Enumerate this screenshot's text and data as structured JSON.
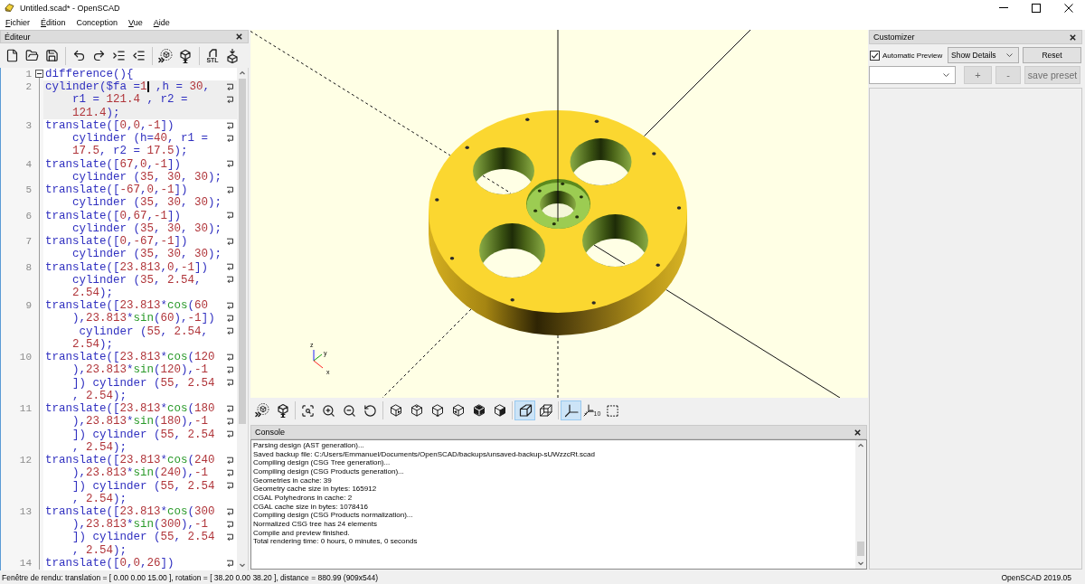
{
  "window": {
    "title": "Untitled.scad* - OpenSCAD"
  },
  "menu": [
    {
      "label": "Fichier",
      "underline_first": true
    },
    {
      "label": "Édition",
      "underline_first": true
    },
    {
      "label": "Conception",
      "underline_first": false
    },
    {
      "label": "Vue",
      "underline_first": true
    },
    {
      "label": "Aide",
      "underline_first": true
    }
  ],
  "editor": {
    "title": "Éditeur",
    "toolbar": [
      {
        "kind": "new"
      },
      {
        "kind": "open"
      },
      {
        "kind": "save"
      },
      {
        "kind": "separator"
      },
      {
        "kind": "undo"
      },
      {
        "kind": "redo"
      },
      {
        "kind": "indent"
      },
      {
        "kind": "unindent"
      },
      {
        "kind": "separator"
      },
      {
        "kind": "preview"
      },
      {
        "kind": "render"
      },
      {
        "kind": "separator"
      },
      {
        "kind": "export_stl",
        "text": "STL"
      },
      {
        "kind": "send_to_print"
      }
    ],
    "lines": [
      {
        "number": "1",
        "fold": true,
        "current": false,
        "continues": false,
        "rows": [
          {
            "text": "difference(){"
          }
        ]
      },
      {
        "number": "2",
        "fold": false,
        "current": true,
        "continues": false,
        "rows": [
          {
            "text": "cylinder($fa =1",
            "cursor_after": true,
            "text_after": " ,h = 30,"
          },
          {
            "text": "r1 = 121.4 , r2 ="
          },
          {
            "text": "121.4);"
          }
        ]
      },
      {
        "number": "3",
        "fold": false,
        "current": false,
        "continues": false,
        "rows": [
          {
            "text": "translate([0,0,-1])"
          },
          {
            "text": "cylinder (h=40, r1 ="
          },
          {
            "text": "17.5, r2 = 17.5);"
          }
        ]
      },
      {
        "number": "4",
        "fold": false,
        "current": false,
        "continues": false,
        "rows": [
          {
            "text": "translate([67,0,-1])"
          },
          {
            "text": "cylinder (35, 30, 30);"
          }
        ]
      },
      {
        "number": "5",
        "fold": false,
        "current": false,
        "continues": false,
        "rows": [
          {
            "text": "translate([-67,0,-1])"
          },
          {
            "text": "cylinder (35, 30, 30);"
          }
        ]
      },
      {
        "number": "6",
        "fold": false,
        "current": false,
        "continues": false,
        "rows": [
          {
            "text": "translate([0,67,-1])"
          },
          {
            "text": "cylinder (35, 30, 30);"
          }
        ]
      },
      {
        "number": "7",
        "fold": false,
        "current": false,
        "continues": false,
        "rows": [
          {
            "text": "translate([0,-67,-1])"
          },
          {
            "text": "cylinder (35, 30, 30);"
          }
        ]
      },
      {
        "number": "8",
        "fold": false,
        "current": false,
        "continues": false,
        "rows": [
          {
            "text": "translate([23.813,0,-1])"
          },
          {
            "text": "cylinder (35, 2.54,"
          },
          {
            "text": "2.54);"
          }
        ]
      },
      {
        "number": "9",
        "fold": false,
        "current": false,
        "continues": false,
        "rows": [
          {
            "text": "translate([23.813*cos(60"
          },
          {
            "text": "),23.813*sin(60),-1])"
          },
          {
            "text": " cylinder (55, 2.54,"
          },
          {
            "text": "2.54);"
          }
        ]
      },
      {
        "number": "10",
        "fold": false,
        "current": false,
        "continues": false,
        "rows": [
          {
            "text": "translate([23.813*cos(120"
          },
          {
            "text": "),23.813*sin(120),-1"
          },
          {
            "text": "]) cylinder (55, 2.54"
          },
          {
            "text": ", 2.54);"
          }
        ]
      },
      {
        "number": "11",
        "fold": false,
        "current": false,
        "continues": false,
        "rows": [
          {
            "text": "translate([23.813*cos(180"
          },
          {
            "text": "),23.813*sin(180),-1"
          },
          {
            "text": "]) cylinder (55, 2.54"
          },
          {
            "text": ", 2.54);"
          }
        ]
      },
      {
        "number": "12",
        "fold": false,
        "current": false,
        "continues": false,
        "rows": [
          {
            "text": "translate([23.813*cos(240"
          },
          {
            "text": "),23.813*sin(240),-1"
          },
          {
            "text": "]) cylinder (55, 2.54"
          },
          {
            "text": ", 2.54);"
          }
        ]
      },
      {
        "number": "13",
        "fold": false,
        "current": false,
        "continues": false,
        "rows": [
          {
            "text": "translate([23.813*cos(300"
          },
          {
            "text": "),23.813*sin(300),-1"
          },
          {
            "text": "]) cylinder (55, 2.54"
          },
          {
            "text": ", 2.54);"
          }
        ]
      },
      {
        "number": "14",
        "fold": false,
        "current": false,
        "continues": true,
        "rows": [
          {
            "text": "translate([0,0,26])"
          }
        ]
      }
    ]
  },
  "viewport": {
    "axis_labels": [
      "z",
      "y",
      "x"
    ]
  },
  "viewport_toolbar": [
    {
      "kind": "preview",
      "selected": false
    },
    {
      "kind": "render",
      "selected": false
    },
    {
      "kind": "separator"
    },
    {
      "kind": "view_all",
      "selected": false
    },
    {
      "kind": "zoom_in",
      "selected": false
    },
    {
      "kind": "zoom_out",
      "selected": false
    },
    {
      "kind": "reset_view",
      "selected": false
    },
    {
      "kind": "separator"
    },
    {
      "kind": "view_right",
      "selected": false
    },
    {
      "kind": "view_top",
      "selected": false
    },
    {
      "kind": "view_bottom",
      "selected": false
    },
    {
      "kind": "view_left",
      "selected": false
    },
    {
      "kind": "view_front",
      "selected": false
    },
    {
      "kind": "view_back",
      "selected": false
    },
    {
      "kind": "separator"
    },
    {
      "kind": "perspective",
      "selected": true
    },
    {
      "kind": "orthogonal",
      "selected": false
    },
    {
      "kind": "separator"
    },
    {
      "kind": "show_axes",
      "selected": true
    },
    {
      "kind": "show_scale_markers",
      "selected": false,
      "text": "10"
    },
    {
      "kind": "show_edges",
      "selected": false
    }
  ],
  "console": {
    "title": "Console",
    "messages": [
      "Parsing design (AST generation)...",
      "Saved backup file: C:/Users/Emmanuel/Documents/OpenSCAD/backups/unsaved-backup-sUWzzcRt.scad",
      "Compiling design (CSG Tree generation)...",
      "Compiling design (CSG Products generation)...",
      "Geometries in cache: 39",
      "Geometry cache size in bytes: 165912",
      "CGAL Polyhedrons in cache: 2",
      "CGAL cache size in bytes: 1078416",
      "Compiling design (CSG Products normalization)...",
      "Normalized CSG tree has 24 elements",
      "Compile and preview finished.",
      "Total rendering time: 0 hours, 0 minutes, 0 seconds"
    ]
  },
  "customizer": {
    "title": "Customizer",
    "automatic_preview": {
      "label": "Automatic Preview",
      "checked": true
    },
    "details": {
      "value": "Show Details"
    },
    "reset": {
      "label": "Reset",
      "disabled": false
    },
    "preset_buttons": [
      {
        "label": "+",
        "disabled": true
      },
      {
        "label": "-",
        "disabled": true
      },
      {
        "label": "save preset",
        "disabled": true
      }
    ]
  },
  "status_bar": {
    "text": "Fenêtre de rendu: translation = [ 0.00 0.00 15.00 ], rotation = [ 38.20 0.00 38.20 ], distance = 880.99 (909x544)",
    "version": "OpenSCAD 2019.05"
  }
}
